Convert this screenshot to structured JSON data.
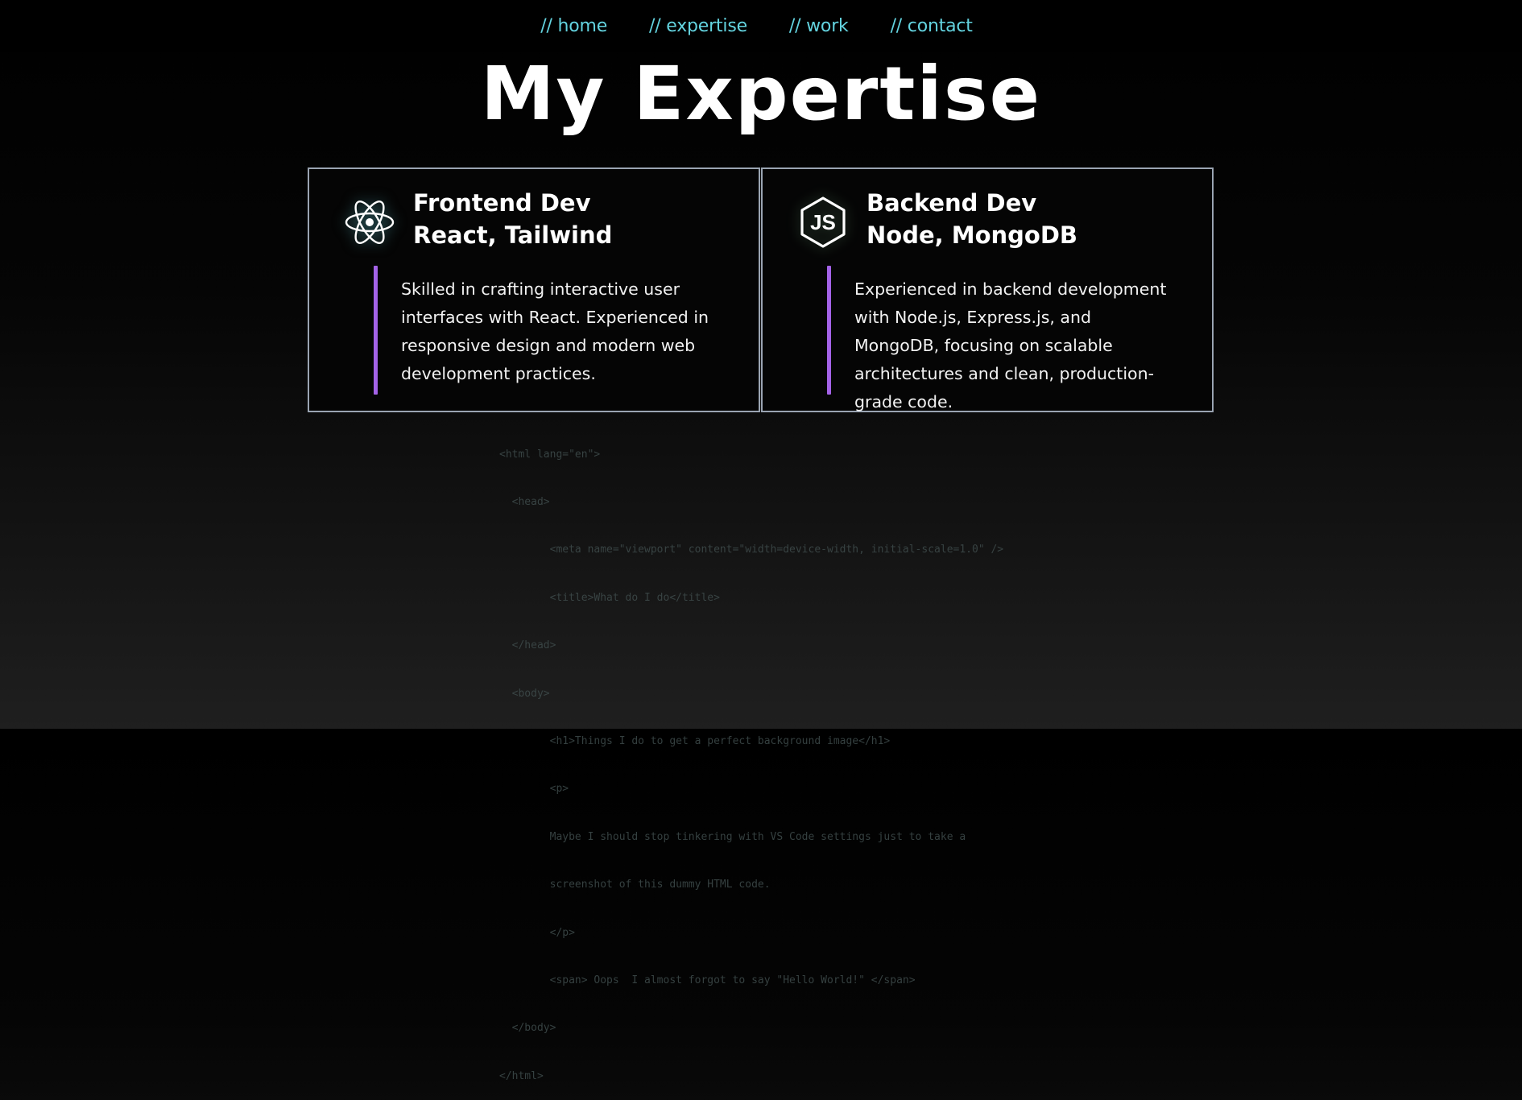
{
  "nav": {
    "items": [
      {
        "label": "// home"
      },
      {
        "label": "// expertise"
      },
      {
        "label": "// work"
      },
      {
        "label": "// contact"
      }
    ]
  },
  "page_title": "My Expertise",
  "cards": [
    {
      "icon": "react-atom-icon",
      "title_line1": "Frontend Dev",
      "title_line2": "React, Tailwind",
      "text": "Skilled in crafting interactive user interfaces with React. Experienced in responsive design and modern web development practices."
    },
    {
      "icon": "nodejs-icon",
      "title_line1": "Backend Dev",
      "title_line2": "Node, MongoDB",
      "text": "Experienced in backend development with Node.js, Express.js, and MongoDB, focusing on scalable architectures and clean, production-grade code."
    }
  ],
  "background_code": [
    "<html lang=\"en\">",
    "  <head>",
    "        <meta name=\"viewport\" content=\"width=device-width, initial-scale=1.0\" />",
    "        <title>What do I do</title>",
    "  </head>",
    "  <body>",
    "        <h1>Things I do to get a perfect background image</h1>",
    "        <p>",
    "        Maybe I should stop tinkering with VS Code settings just to take a",
    "        screenshot of this dummy HTML code.",
    "        </p>",
    "        <span> Oops  I almost forgot to say \"Hello World!\" </span>",
    "  </body>",
    "</html>"
  ],
  "colors": {
    "nav_link": "#63d3df",
    "accent_bar": "#a463e8",
    "card_border": "#9aa4b2"
  }
}
